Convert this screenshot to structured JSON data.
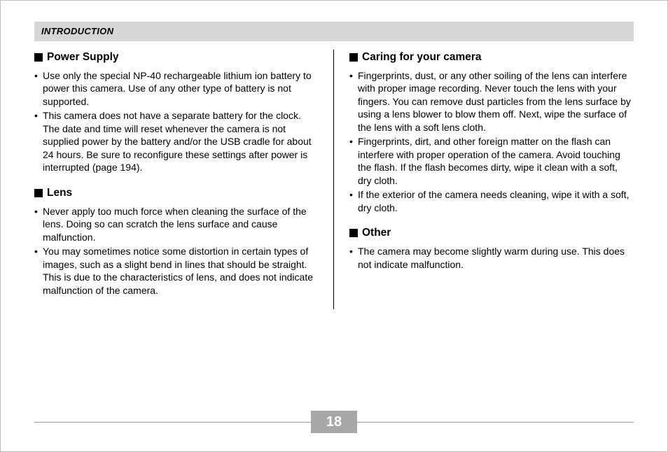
{
  "header": "INTRODUCTION",
  "page_number": "18",
  "left": {
    "sections": [
      {
        "heading": "Power Supply",
        "items": [
          "Use only the special NP-40 rechargeable lithium ion battery to power this camera. Use of any other type of battery is not supported.",
          "This camera does not have a separate battery for the clock. The date and time will reset whenever the camera is not supplied power by the battery and/or the USB cradle for about 24 hours. Be sure to reconfigure these settings after power is interrupted (page 194)."
        ]
      },
      {
        "heading": "Lens",
        "items": [
          "Never apply too much force when cleaning the surface of the lens. Doing so can scratch the lens surface and cause malfunction.",
          "You may sometimes notice some distortion in certain types of images, such as a slight bend in lines that should be straight. This is due to the characteristics of lens, and does not indicate malfunction of the camera."
        ]
      }
    ]
  },
  "right": {
    "sections": [
      {
        "heading": "Caring for your camera",
        "items": [
          "Fingerprints, dust, or any other soiling of the lens can interfere with proper image recording. Never touch the lens with your fingers. You can remove dust particles from the lens surface by using a lens blower to blow them off. Next, wipe the surface of the lens with a soft lens cloth.",
          "Fingerprints, dirt, and other foreign matter on the flash can interfere with proper operation of the camera. Avoid touching the flash. If the flash becomes dirty, wipe it clean with a soft, dry cloth.",
          "If the exterior of the camera needs cleaning, wipe it with a soft, dry cloth."
        ]
      },
      {
        "heading": "Other",
        "items": [
          "The camera may become slightly warm during use. This does not indicate malfunction."
        ]
      }
    ]
  }
}
